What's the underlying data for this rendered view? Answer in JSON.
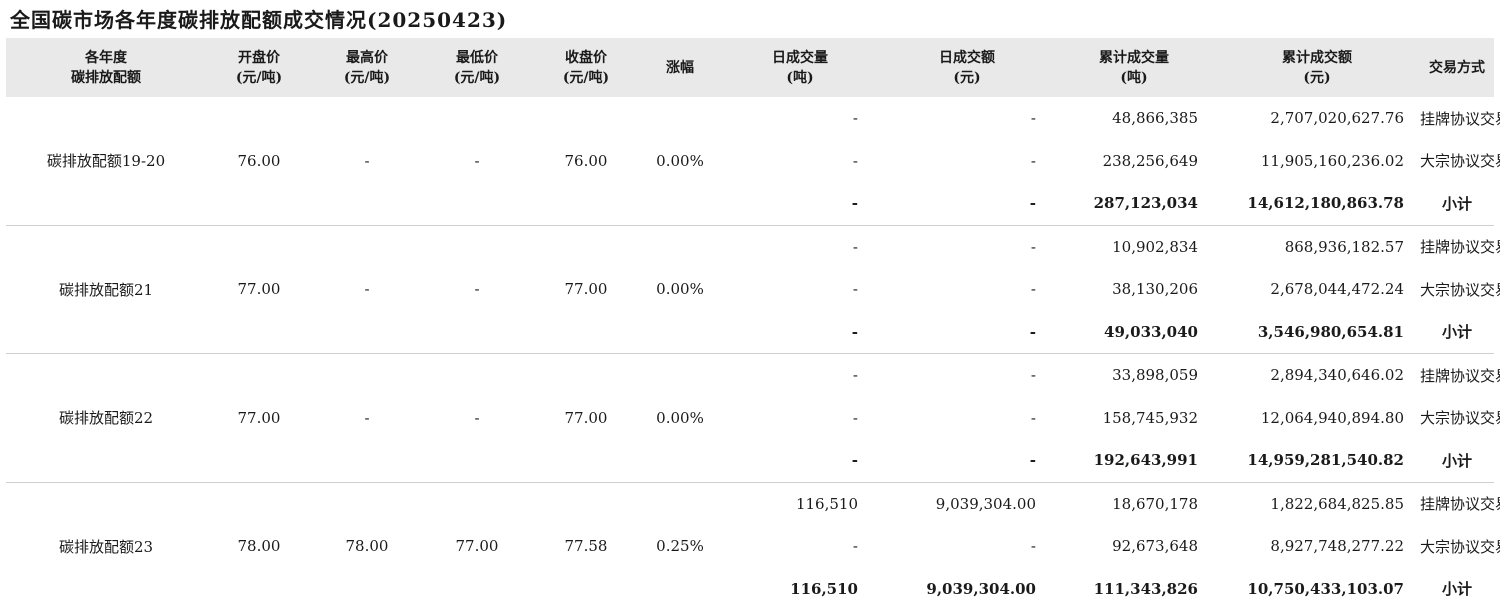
{
  "title": "全国碳市场各年度碳排放配额成交情况(20250423)",
  "headers": {
    "product": [
      "各年度",
      "碳排放配额"
    ],
    "open": [
      "开盘价",
      "(元/吨)"
    ],
    "high": [
      "最高价",
      "(元/吨)"
    ],
    "low": [
      "最低价",
      "(元/吨)"
    ],
    "close": [
      "收盘价",
      "(元/吨)"
    ],
    "change": [
      "涨幅"
    ],
    "daily_volume": [
      "日成交量",
      "(吨)"
    ],
    "daily_amount": [
      "日成交额",
      "(元)"
    ],
    "cum_volume": [
      "累计成交量",
      "(吨)"
    ],
    "cum_amount": [
      "累计成交额",
      "(元)"
    ],
    "method": [
      "交易方式"
    ]
  },
  "groups": [
    {
      "product": "碳排放配额19-20",
      "open": "76.00",
      "high": "-",
      "low": "-",
      "close": "76.00",
      "change": "0.00%",
      "rows": [
        {
          "daily_volume": "-",
          "daily_amount": "-",
          "cum_volume": "48,866,385",
          "cum_amount": "2,707,020,627.76",
          "method": "挂牌协议交易"
        },
        {
          "daily_volume": "-",
          "daily_amount": "-",
          "cum_volume": "238,256,649",
          "cum_amount": "11,905,160,236.02",
          "method": "大宗协议交易"
        },
        {
          "daily_volume": "-",
          "daily_amount": "-",
          "cum_volume": "287,123,034",
          "cum_amount": "14,612,180,863.78",
          "method": "小计"
        }
      ]
    },
    {
      "product": "碳排放配额21",
      "open": "77.00",
      "high": "-",
      "low": "-",
      "close": "77.00",
      "change": "0.00%",
      "rows": [
        {
          "daily_volume": "-",
          "daily_amount": "-",
          "cum_volume": "10,902,834",
          "cum_amount": "868,936,182.57",
          "method": "挂牌协议交易"
        },
        {
          "daily_volume": "-",
          "daily_amount": "-",
          "cum_volume": "38,130,206",
          "cum_amount": "2,678,044,472.24",
          "method": "大宗协议交易"
        },
        {
          "daily_volume": "-",
          "daily_amount": "-",
          "cum_volume": "49,033,040",
          "cum_amount": "3,546,980,654.81",
          "method": "小计"
        }
      ]
    },
    {
      "product": "碳排放配额22",
      "open": "77.00",
      "high": "-",
      "low": "-",
      "close": "77.00",
      "change": "0.00%",
      "rows": [
        {
          "daily_volume": "-",
          "daily_amount": "-",
          "cum_volume": "33,898,059",
          "cum_amount": "2,894,340,646.02",
          "method": "挂牌协议交易"
        },
        {
          "daily_volume": "-",
          "daily_amount": "-",
          "cum_volume": "158,745,932",
          "cum_amount": "12,064,940,894.80",
          "method": "大宗协议交易"
        },
        {
          "daily_volume": "-",
          "daily_amount": "-",
          "cum_volume": "192,643,991",
          "cum_amount": "14,959,281,540.82",
          "method": "小计"
        }
      ]
    },
    {
      "product": "碳排放配额23",
      "open": "78.00",
      "high": "78.00",
      "low": "77.00",
      "close": "77.58",
      "change": "0.25%",
      "rows": [
        {
          "daily_volume": "116,510",
          "daily_amount": "9,039,304.00",
          "cum_volume": "18,670,178",
          "cum_amount": "1,822,684,825.85",
          "method": "挂牌协议交易"
        },
        {
          "daily_volume": "-",
          "daily_amount": "-",
          "cum_volume": "92,673,648",
          "cum_amount": "8,927,748,277.22",
          "method": "大宗协议交易"
        },
        {
          "daily_volume": "116,510",
          "daily_amount": "9,039,304.00",
          "cum_volume": "111,343,826",
          "cum_amount": "10,750,433,103.07",
          "method": "小计"
        }
      ]
    }
  ]
}
